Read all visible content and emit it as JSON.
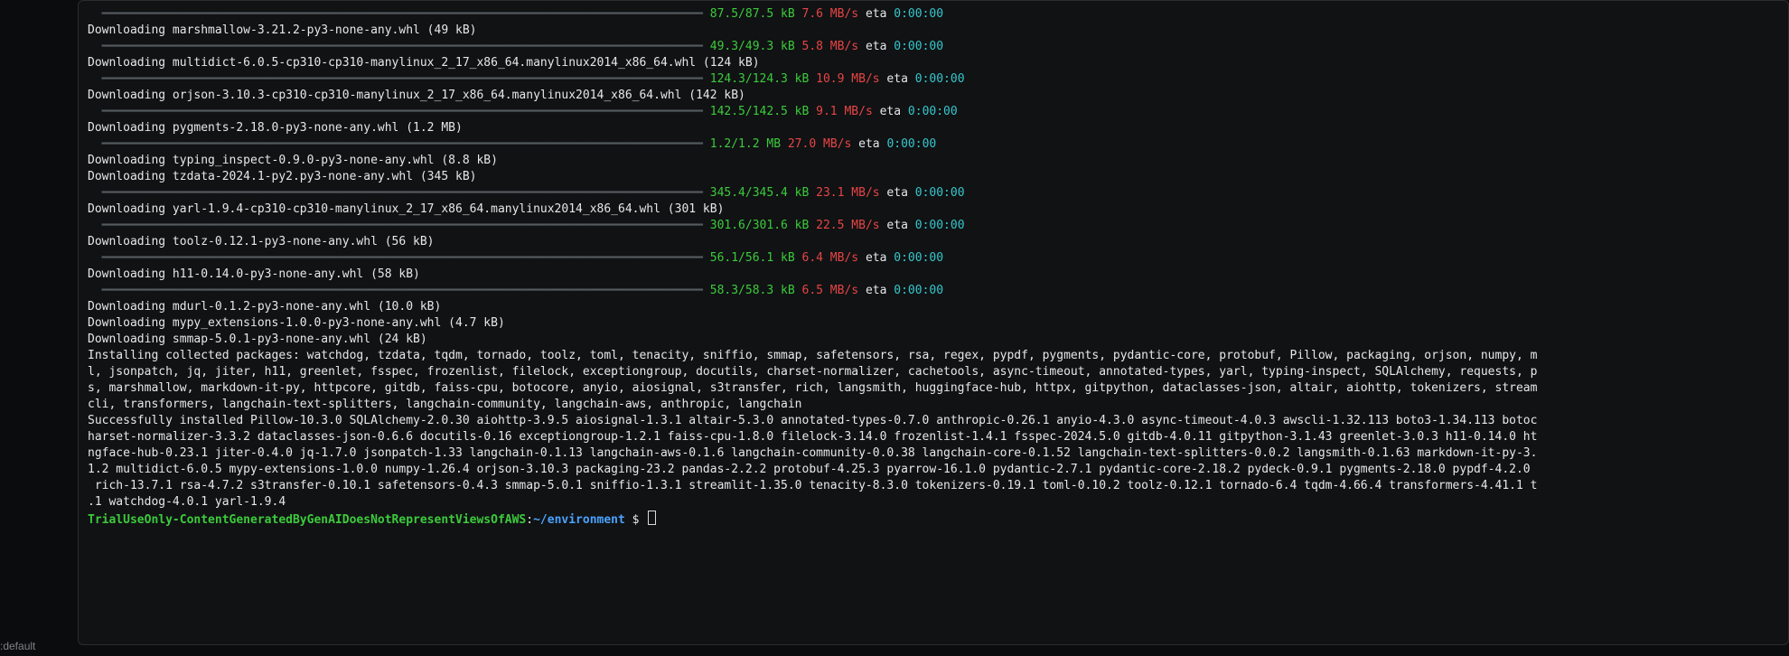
{
  "progress_bar": "  ━━━━━━━━━━━━━━━━━━━━━━━━━━━━━━━━━━━━━━━━━━━━━━━━━━━━━━━━━━━━━━━━━━━━━━━━━━━━━━━━━━━━━ ",
  "eta_label": " eta ",
  "eta_val": "0:00:00",
  "p0": {
    "size": "87.5/87.5 kB",
    "speed": "7.6 MB/s"
  },
  "d1": "Downloading marshmallow-3.21.2-py3-none-any.whl (49 kB)",
  "p1": {
    "size": "49.3/49.3 kB",
    "speed": "5.8 MB/s"
  },
  "d2": "Downloading multidict-6.0.5-cp310-cp310-manylinux_2_17_x86_64.manylinux2014_x86_64.whl (124 kB)",
  "p2": {
    "size": "124.3/124.3 kB",
    "speed": "10.9 MB/s"
  },
  "d3": "Downloading orjson-3.10.3-cp310-cp310-manylinux_2_17_x86_64.manylinux2014_x86_64.whl (142 kB)",
  "p3": {
    "size": "142.5/142.5 kB",
    "speed": "9.1 MB/s"
  },
  "d4": "Downloading pygments-2.18.0-py3-none-any.whl (1.2 MB)",
  "p4": {
    "size": "1.2/1.2 MB",
    "speed": "27.0 MB/s"
  },
  "d5": "Downloading typing_inspect-0.9.0-py3-none-any.whl (8.8 kB)",
  "d6": "Downloading tzdata-2024.1-py2.py3-none-any.whl (345 kB)",
  "p6": {
    "size": "345.4/345.4 kB",
    "speed": "23.1 MB/s"
  },
  "d7": "Downloading yarl-1.9.4-cp310-cp310-manylinux_2_17_x86_64.manylinux2014_x86_64.whl (301 kB)",
  "p7": {
    "size": "301.6/301.6 kB",
    "speed": "22.5 MB/s"
  },
  "d8": "Downloading toolz-0.12.1-py3-none-any.whl (56 kB)",
  "p8": {
    "size": "56.1/56.1 kB",
    "speed": "6.4 MB/s"
  },
  "d9": "Downloading h11-0.14.0-py3-none-any.whl (58 kB)",
  "p9": {
    "size": "58.3/58.3 kB",
    "speed": "6.5 MB/s"
  },
  "d10": "Downloading mdurl-0.1.2-py3-none-any.whl (10.0 kB)",
  "d11": "Downloading mypy_extensions-1.0.0-py3-none-any.whl (4.7 kB)",
  "d12": "Downloading smmap-5.0.1-py3-none-any.whl (24 kB)",
  "install1": "Installing collected packages: watchdog, tzdata, tqdm, tornado, toolz, toml, tenacity, sniffio, smmap, safetensors, rsa, regex, pypdf, pygments, pydantic-core, protobuf, Pillow, packaging, orjson, numpy, m",
  "install2": "l, jsonpatch, jq, jiter, h11, greenlet, fsspec, frozenlist, filelock, exceptiongroup, docutils, charset-normalizer, cachetools, async-timeout, annotated-types, yarl, typing-inspect, SQLAlchemy, requests, p",
  "install3": "s, marshmallow, markdown-it-py, httpcore, gitdb, faiss-cpu, botocore, anyio, aiosignal, s3transfer, rich, langsmith, huggingface-hub, httpx, gitpython, dataclasses-json, altair, aiohttp, tokenizers, stream",
  "install4": "cli, transformers, langchain-text-splitters, langchain-community, langchain-aws, anthropic, langchain",
  "success1": "Successfully installed Pillow-10.3.0 SQLAlchemy-2.0.30 aiohttp-3.9.5 aiosignal-1.3.1 altair-5.3.0 annotated-types-0.7.0 anthropic-0.26.1 anyio-4.3.0 async-timeout-4.0.3 awscli-1.32.113 boto3-1.34.113 botoc",
  "success2": "harset-normalizer-3.3.2 dataclasses-json-0.6.6 docutils-0.16 exceptiongroup-1.2.1 faiss-cpu-1.8.0 filelock-3.14.0 frozenlist-1.4.1 fsspec-2024.5.0 gitdb-4.0.11 gitpython-3.1.43 greenlet-3.0.3 h11-0.14.0 ht",
  "success3": "ngface-hub-0.23.1 jiter-0.4.0 jq-1.7.0 jsonpatch-1.33 langchain-0.1.13 langchain-aws-0.1.6 langchain-community-0.0.38 langchain-core-0.1.52 langchain-text-splitters-0.0.2 langsmith-0.1.63 markdown-it-py-3.",
  "success4": "1.2 multidict-6.0.5 mypy-extensions-1.0.0 numpy-1.26.4 orjson-3.10.3 packaging-23.2 pandas-2.2.2 protobuf-4.25.3 pyarrow-16.1.0 pydantic-2.7.1 pydantic-core-2.18.2 pydeck-0.9.1 pygments-2.18.0 pypdf-4.2.0",
  "success5": " rich-13.7.1 rsa-4.7.2 s3transfer-0.10.1 safetensors-0.4.3 smmap-5.0.1 sniffio-1.3.1 streamlit-1.35.0 tenacity-8.3.0 tokenizers-0.19.1 toml-0.10.2 toolz-0.12.1 tornado-6.4 tqdm-4.66.4 transformers-4.41.1 t",
  "success6": ".1 watchdog-4.0.1 yarl-1.9.4",
  "prompt_host": "TrialUseOnly-ContentGeneratedByGenAIDoesNotRepresentViewsOfAWS",
  "prompt_sep": ":",
  "prompt_path": "~/environment",
  "prompt_sym": " $ ",
  "bottom_left": ":default"
}
